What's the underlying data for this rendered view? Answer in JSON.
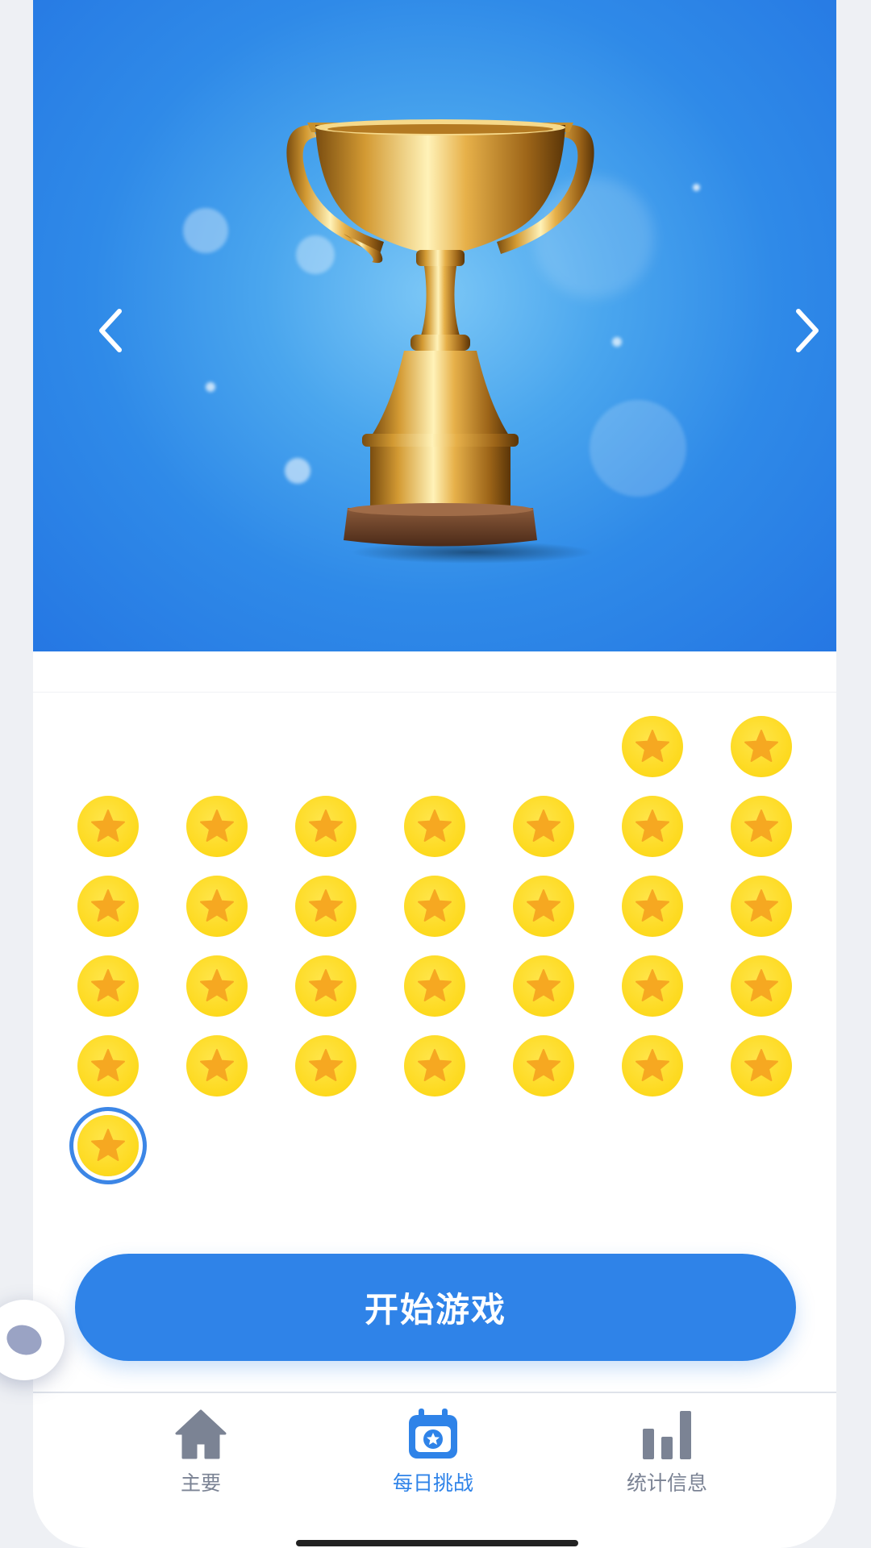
{
  "hero": {
    "image": "gold-trophy",
    "prev_icon": "chevron-left-icon",
    "next_icon": "chevron-right-icon"
  },
  "medals": {
    "icon": "star-medal-icon",
    "rows": [
      [
        null,
        null,
        null,
        null,
        null,
        "star",
        "star"
      ],
      [
        "star",
        "star",
        "star",
        "star",
        "star",
        "star",
        "star"
      ],
      [
        "star",
        "star",
        "star",
        "star",
        "star",
        "star",
        "star"
      ],
      [
        "star",
        "star",
        "star",
        "star",
        "star",
        "star",
        "star"
      ],
      [
        "star",
        "star",
        "star",
        "star",
        "star",
        "star",
        "star"
      ],
      [
        "star-selected",
        null,
        null,
        null,
        null,
        null,
        null
      ]
    ],
    "colors": {
      "medal": "#fdd91d",
      "star": "#f6a821",
      "selected_ring": "#3c86e6"
    }
  },
  "start_button": {
    "label": "开始游戏",
    "color": "#2f83e8"
  },
  "tabbar": {
    "tabs": [
      {
        "label": "主要",
        "icon": "home-icon",
        "active": false
      },
      {
        "label": "每日挑战",
        "icon": "calendar-star-icon",
        "active": true
      },
      {
        "label": "统计信息",
        "icon": "bar-chart-icon",
        "active": false
      }
    ],
    "active_color": "#2f83e8",
    "inactive_color": "#7b8394"
  }
}
